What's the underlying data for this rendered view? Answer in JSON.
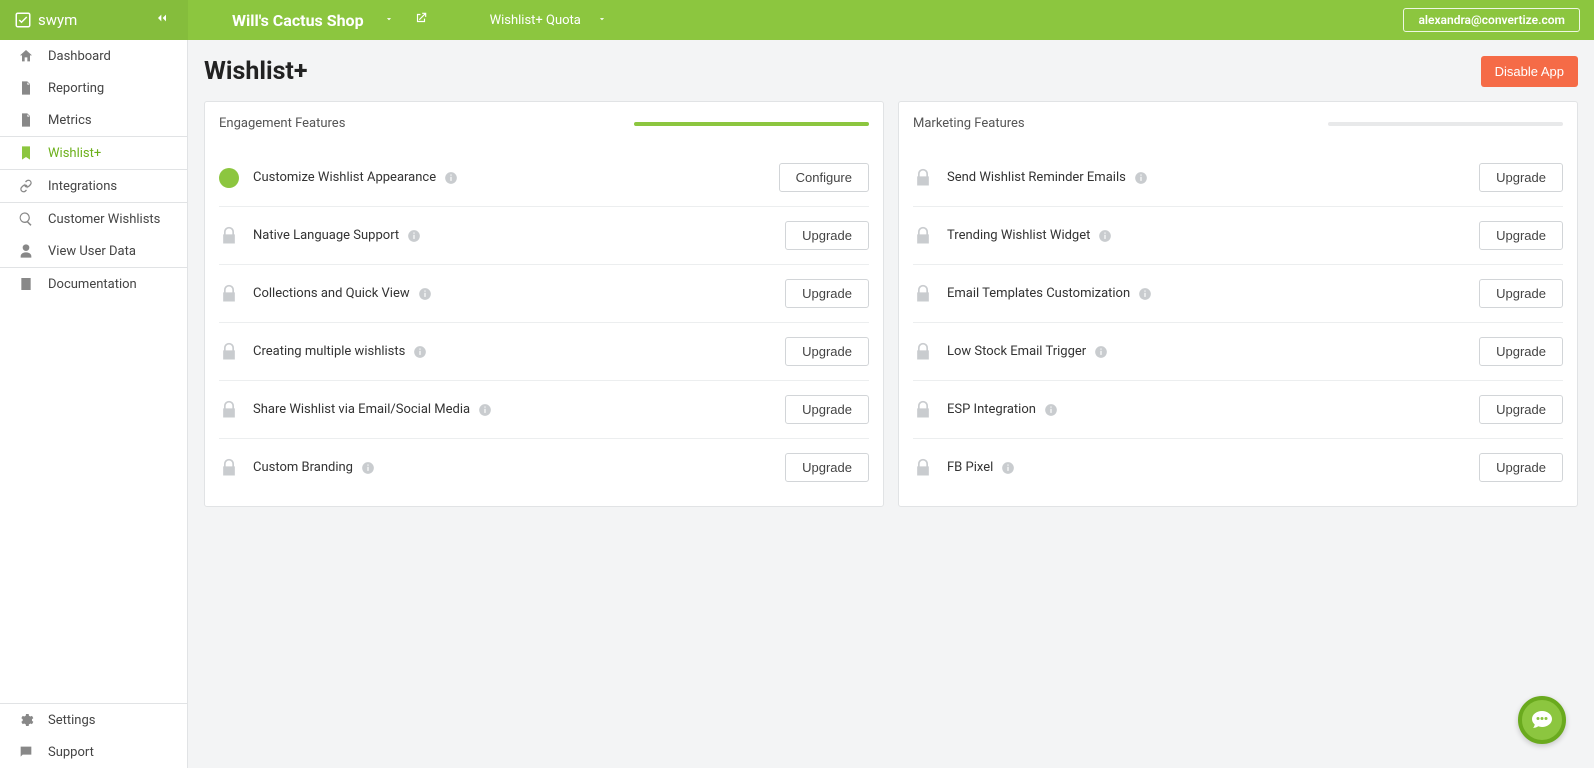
{
  "brand": "swym",
  "header": {
    "shop_name": "Will's Cactus Shop",
    "quota_label": "Wishlist+ Quota",
    "user_email": "alexandra@convertize.com"
  },
  "sidebar": {
    "items": [
      {
        "label": "Dashboard",
        "icon": "dashboard"
      },
      {
        "label": "Reporting",
        "icon": "file"
      },
      {
        "label": "Metrics",
        "icon": "file"
      },
      {
        "label": "Wishlist+",
        "icon": "bookmark"
      },
      {
        "label": "Integrations",
        "icon": "link"
      },
      {
        "label": "Customer Wishlists",
        "icon": "search"
      },
      {
        "label": "View User Data",
        "icon": "user"
      },
      {
        "label": "Documentation",
        "icon": "doc"
      }
    ],
    "bottom": [
      {
        "label": "Settings",
        "icon": "gear"
      },
      {
        "label": "Support",
        "icon": "chat"
      }
    ]
  },
  "page": {
    "title": "Wishlist+",
    "disable_btn": "Disable App"
  },
  "panels": {
    "engagement": {
      "title": "Engagement Features",
      "progress_pct": 100,
      "items": [
        {
          "label": "Customize Wishlist Appearance",
          "status": "on",
          "btn": "Configure"
        },
        {
          "label": "Native Language Support",
          "status": "locked",
          "btn": "Upgrade"
        },
        {
          "label": "Collections and Quick View",
          "status": "locked",
          "btn": "Upgrade"
        },
        {
          "label": "Creating multiple wishlists",
          "status": "locked",
          "btn": "Upgrade"
        },
        {
          "label": "Share Wishlist via Email/Social Media",
          "status": "locked",
          "btn": "Upgrade"
        },
        {
          "label": "Custom Branding",
          "status": "locked",
          "btn": "Upgrade"
        }
      ]
    },
    "marketing": {
      "title": "Marketing Features",
      "progress_pct": 0,
      "items": [
        {
          "label": "Send Wishlist Reminder Emails",
          "status": "locked",
          "btn": "Upgrade"
        },
        {
          "label": "Trending Wishlist Widget",
          "status": "locked",
          "btn": "Upgrade"
        },
        {
          "label": "Email Templates Customization",
          "status": "locked",
          "btn": "Upgrade"
        },
        {
          "label": "Low Stock Email Trigger",
          "status": "locked",
          "btn": "Upgrade"
        },
        {
          "label": "ESP Integration",
          "status": "locked",
          "btn": "Upgrade"
        },
        {
          "label": "FB Pixel",
          "status": "locked",
          "btn": "Upgrade"
        }
      ]
    }
  }
}
